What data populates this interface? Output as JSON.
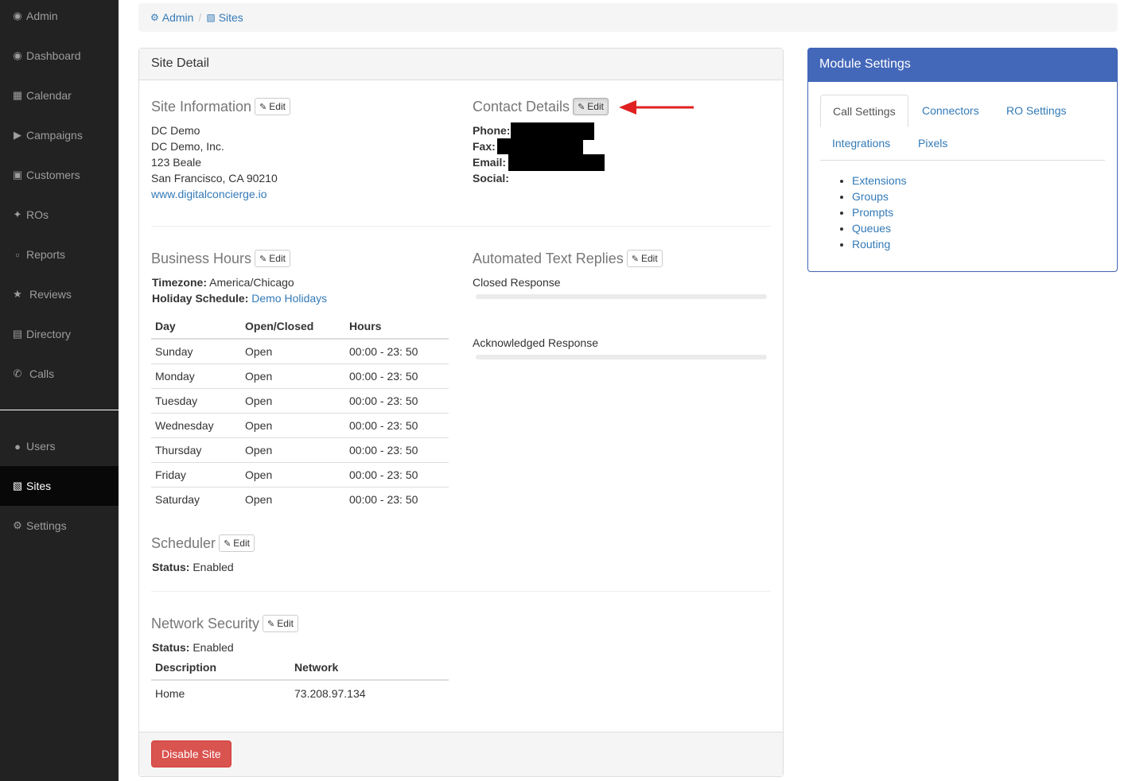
{
  "sidebar": {
    "items": [
      {
        "label": "Admin",
        "icon": "dashboard-icon"
      },
      {
        "label": "Dashboard",
        "icon": "dashboard-icon"
      },
      {
        "label": "Calendar",
        "icon": "calendar-icon"
      },
      {
        "label": "Campaigns",
        "icon": "bullhorn-icon"
      },
      {
        "label": "Customers",
        "icon": "contact-card-icon"
      },
      {
        "label": "ROs",
        "icon": "wrench-icon"
      },
      {
        "label": "Reports",
        "icon": "bar-chart-icon"
      },
      {
        "label": "Reviews",
        "icon": "star-icon"
      },
      {
        "label": "Directory",
        "icon": "book-icon"
      },
      {
        "label": "Calls",
        "icon": "phone-icon"
      }
    ],
    "admin_items": [
      {
        "label": "Users",
        "icon": "users-icon"
      },
      {
        "label": "Sites",
        "icon": "building-icon",
        "active": true
      },
      {
        "label": "Settings",
        "icon": "gear-icon"
      }
    ]
  },
  "breadcrumb": {
    "admin": "Admin",
    "separator": "/",
    "sites": "Sites"
  },
  "site_detail": {
    "panel_title": "Site Detail",
    "edit_label": "Edit",
    "site_information": {
      "title": "Site Information",
      "name": "DC Demo",
      "company": "DC Demo, Inc.",
      "street": "123 Beale",
      "city_state_zip": "San Francisco, CA 90210",
      "website": "www.digitalconcierge.io"
    },
    "contact_details": {
      "title": "Contact Details",
      "phone_label": "Phone:",
      "fax_label": "Fax:",
      "email_label": "Email:",
      "social_label": "Social:"
    },
    "business_hours": {
      "title": "Business Hours",
      "timezone_label": "Timezone:",
      "timezone": "America/Chicago",
      "holiday_label": "Holiday Schedule:",
      "holiday_value": "Demo Holidays",
      "columns": [
        "Day",
        "Open/Closed",
        "Hours"
      ],
      "rows": [
        [
          "Sunday",
          "Open",
          "00:00 - 23: 50"
        ],
        [
          "Monday",
          "Open",
          "00:00 - 23: 50"
        ],
        [
          "Tuesday",
          "Open",
          "00:00 - 23: 50"
        ],
        [
          "Wednesday",
          "Open",
          "00:00 - 23: 50"
        ],
        [
          "Thursday",
          "Open",
          "00:00 - 23: 50"
        ],
        [
          "Friday",
          "Open",
          "00:00 - 23: 50"
        ],
        [
          "Saturday",
          "Open",
          "00:00 - 23: 50"
        ]
      ]
    },
    "automated_text_replies": {
      "title": "Automated Text Replies",
      "closed_response": "Closed Response",
      "acknowledged_response": "Acknowledged Response"
    },
    "scheduler": {
      "title": "Scheduler",
      "status_label": "Status:",
      "status": "Enabled"
    },
    "network_security": {
      "title": "Network Security",
      "status_label": "Status:",
      "status": "Enabled",
      "columns": [
        "Description",
        "Network"
      ],
      "rows": [
        [
          "Home",
          "73.208.97.134"
        ]
      ]
    },
    "disable_button": "Disable Site"
  },
  "module_settings": {
    "title": "Module Settings",
    "tabs": [
      "Call Settings",
      "Connectors",
      "RO Settings",
      "Integrations",
      "Pixels"
    ],
    "active_tab": "Call Settings",
    "links": [
      "Extensions",
      "Groups",
      "Prompts",
      "Queues",
      "Routing"
    ]
  },
  "colors": {
    "sidebar_bg": "#222222",
    "link": "#337ab7",
    "module_header": "#4468b9",
    "danger": "#d9534f",
    "annotation_arrow": "#e02020"
  }
}
